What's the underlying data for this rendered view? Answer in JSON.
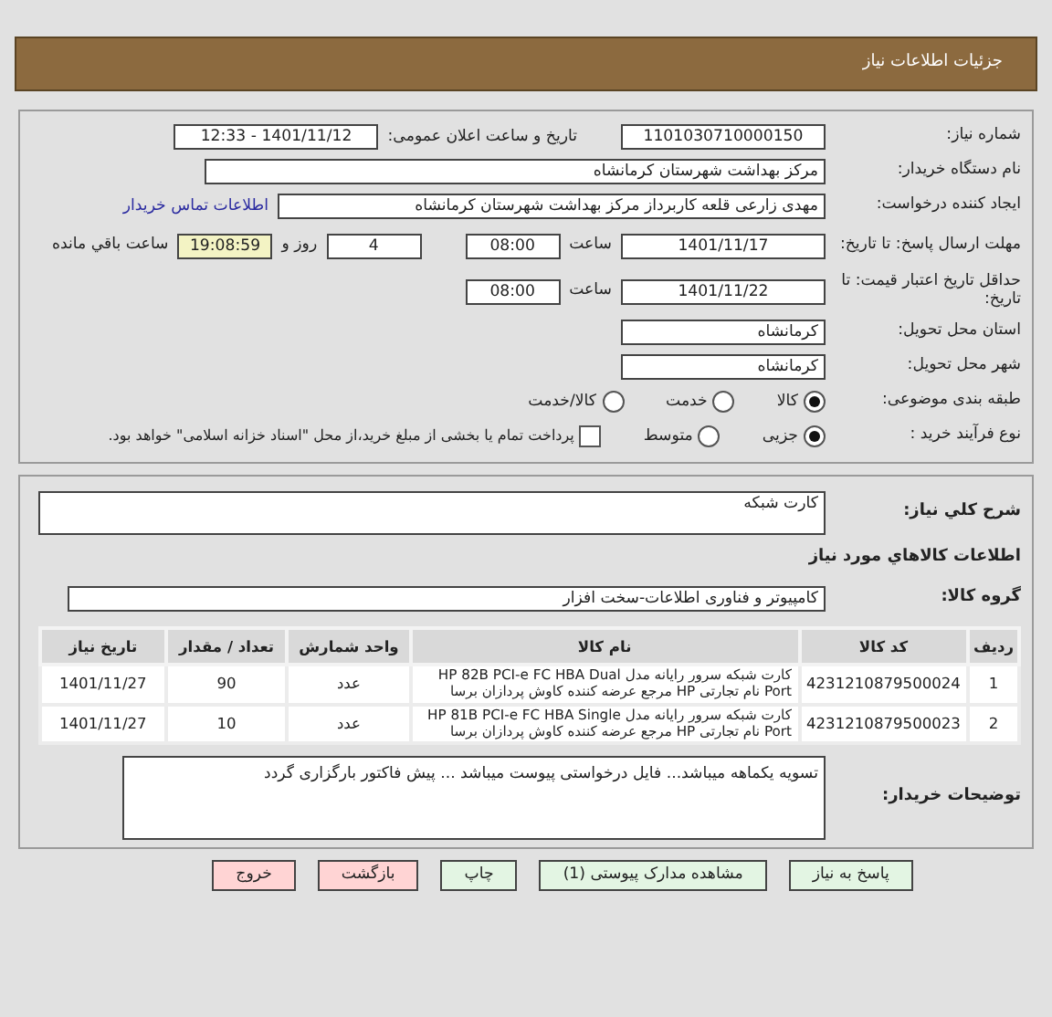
{
  "header": {
    "title": "جزئیات اطلاعات نیاز"
  },
  "details": {
    "need_number": {
      "label": "شماره نیاز:",
      "value": "1101030710000150"
    },
    "announce": {
      "label": "تاریخ و ساعت اعلان عمومی:",
      "value": "1401/11/12 - 12:33"
    },
    "buyer": {
      "label": "نام دستگاه خریدار:",
      "value": "مرکز بهداشت شهرستان کرمانشاه"
    },
    "requester": {
      "label": "ایجاد کننده درخواست:",
      "value": "مهدی  زارعی قلعه کاربرداز مرکز بهداشت شهرستان کرمانشاه",
      "link": "اطلاعات تماس خریدار"
    },
    "deadline": {
      "label": "مهلت ارسال پاسخ: تا تاریخ:",
      "date": "1401/11/17",
      "time_label": "ساعت",
      "time": "08:00",
      "days": "4",
      "days_label": "روز و",
      "remaining": "19:08:59",
      "remaining_label": "ساعت باقي مانده"
    },
    "validity": {
      "label": "حداقل تاریخ اعتبار قیمت: تا تاریخ:",
      "date": "1401/11/22",
      "time_label": "ساعت",
      "time": "08:00"
    },
    "province": {
      "label": "استان محل تحویل:",
      "value": "کرمانشاه"
    },
    "city": {
      "label": "شهر محل تحویل:",
      "value": "کرمانشاه"
    },
    "category": {
      "label": "طبقه بندی موضوعی:",
      "options": [
        {
          "label": "کالا",
          "selected": true
        },
        {
          "label": "خدمت",
          "selected": false
        },
        {
          "label": "کالا/خدمت",
          "selected": false
        }
      ]
    },
    "process": {
      "label": "نوع فرآیند خرید :",
      "options": [
        {
          "label": "جزیی",
          "selected": true
        },
        {
          "label": "متوسط",
          "selected": false
        }
      ],
      "treasury": {
        "label": "پرداخت تمام یا بخشی از مبلغ خرید،از محل \"اسناد خزانه اسلامی\" خواهد بود.",
        "checked": false
      }
    }
  },
  "need": {
    "description": {
      "label": "شرح کلي نیاز:",
      "value": "کارت شبکه"
    },
    "goods_title": "اطلاعات کالاهاي مورد نیاز",
    "group": {
      "label": "گروه کالا:",
      "value": "کامپیوتر و فناوری اطلاعات-سخت افزار"
    },
    "table": {
      "columns": [
        "ردیف",
        "کد کالا",
        "نام کالا",
        "واحد شمارش",
        "تعداد / مقدار",
        "تاریخ نیاز"
      ],
      "rows": [
        [
          "1",
          "4231210879500024",
          "کارت شبکه سرور رایانه مدل HP 82B PCI-e FC HBA Dual Port نام تجارتی HP مرجع عرضه کننده کاوش پردازان برسا",
          "عدد",
          "90",
          "1401/11/27"
        ],
        [
          "2",
          "4231210879500023",
          "کارت شبکه سرور رایانه مدل HP 81B PCI-e FC HBA Single Port نام تجارتی HP مرجع عرضه کننده کاوش پردازان برسا",
          "عدد",
          "10",
          "1401/11/27"
        ]
      ]
    },
    "notes": {
      "label": "توضیحات خریدار:",
      "value": "تسویه یکماهه میباشد... فایل درخواستی پیوست میباشد ... پیش فاکتور بارگزاری گردد"
    }
  },
  "buttons": [
    {
      "label": "پاسخ به نیاز",
      "kind": "normal"
    },
    {
      "label": "مشاهده مدارک پیوستی (1)",
      "kind": "normal"
    },
    {
      "label": "چاپ",
      "kind": "normal"
    },
    {
      "label": "بازگشت",
      "kind": "danger"
    },
    {
      "label": "خروج",
      "kind": "danger"
    }
  ]
}
